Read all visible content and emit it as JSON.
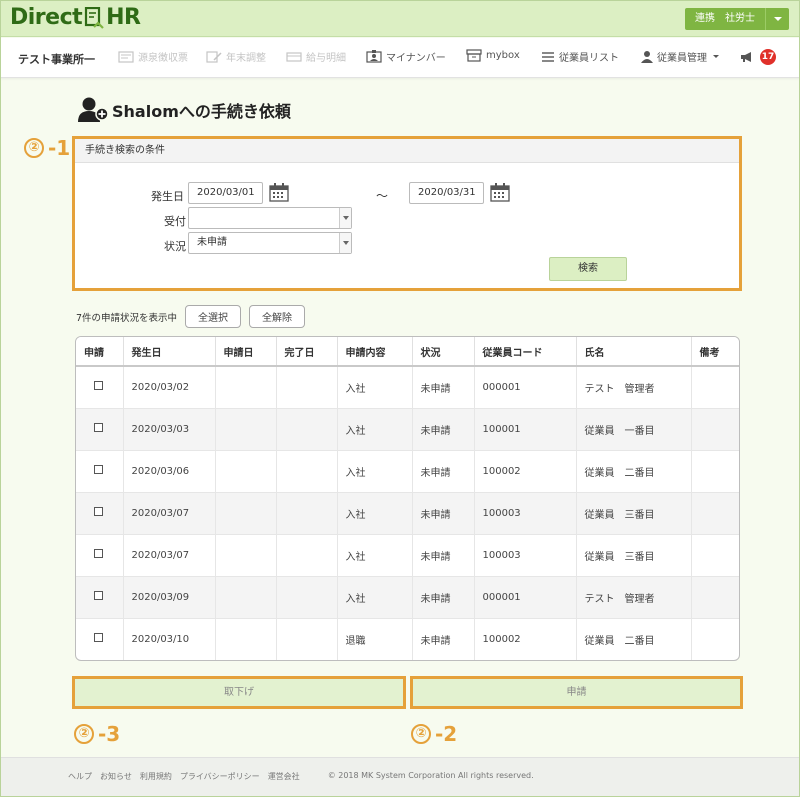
{
  "header": {
    "logo_left": "Direct",
    "logo_right": "HR",
    "user_label": "連携　社労士"
  },
  "nav": {
    "office": "テスト事業所一",
    "items": [
      {
        "label": "源泉徴収票"
      },
      {
        "label": "年末調整"
      },
      {
        "label": "給与明細"
      },
      {
        "label": "マイナンバー"
      },
      {
        "label": "mybox"
      },
      {
        "label": "従業員リスト"
      },
      {
        "label": "従業員管理"
      }
    ],
    "notification_count": "17"
  },
  "page": {
    "title": "Shalomへの手続き依頼"
  },
  "annotations": {
    "a1_num": "②",
    "a1_suffix": "-1",
    "a2_num": "②",
    "a2_suffix": "-2",
    "a3_num": "②",
    "a3_suffix": "-3"
  },
  "search": {
    "header": "手続き検索の条件",
    "date_label": "発生日",
    "date_from": "2020/03/01",
    "tilde": "～",
    "date_to": "2020/03/31",
    "reception_label": "受付",
    "reception_value": "",
    "status_label": "状況",
    "status_value": "未申請",
    "search_button": "検索"
  },
  "list": {
    "count_text": "7件の申請状況を表示中",
    "select_all": "全選択",
    "deselect_all": "全解除",
    "columns": [
      "申請",
      "発生日",
      "申請日",
      "完了日",
      "申請内容",
      "状況",
      "従業員コード",
      "氏名",
      "備考"
    ],
    "rows": [
      {
        "date": "2020/03/02",
        "applied": "",
        "done": "",
        "content": "入社",
        "status": "未申請",
        "code": "000001",
        "name": "テスト　管理者",
        "note": ""
      },
      {
        "date": "2020/03/03",
        "applied": "",
        "done": "",
        "content": "入社",
        "status": "未申請",
        "code": "100001",
        "name": "従業員　一番目",
        "note": ""
      },
      {
        "date": "2020/03/06",
        "applied": "",
        "done": "",
        "content": "入社",
        "status": "未申請",
        "code": "100002",
        "name": "従業員　二番目",
        "note": ""
      },
      {
        "date": "2020/03/07",
        "applied": "",
        "done": "",
        "content": "入社",
        "status": "未申請",
        "code": "100003",
        "name": "従業員　三番目",
        "note": ""
      },
      {
        "date": "2020/03/07",
        "applied": "",
        "done": "",
        "content": "入社",
        "status": "未申請",
        "code": "100003",
        "name": "従業員　三番目",
        "note": ""
      },
      {
        "date": "2020/03/09",
        "applied": "",
        "done": "",
        "content": "入社",
        "status": "未申請",
        "code": "000001",
        "name": "テスト　管理者",
        "note": ""
      },
      {
        "date": "2020/03/10",
        "applied": "",
        "done": "",
        "content": "退職",
        "status": "未申請",
        "code": "100002",
        "name": "従業員　二番目",
        "note": ""
      }
    ]
  },
  "actions": {
    "withdraw": "取下げ",
    "apply": "申請"
  },
  "footer": {
    "links": [
      "ヘルプ",
      "お知らせ",
      "利用規約",
      "プライバシーポリシー",
      "運営会社"
    ],
    "copyright": "© 2018 MK System Corporation All rights reserved."
  },
  "colors": {
    "brand_green": "#7fb542",
    "header_bg": "#dcefc3",
    "annotation_orange": "#e5a13a",
    "badge_red": "#e0302a"
  }
}
